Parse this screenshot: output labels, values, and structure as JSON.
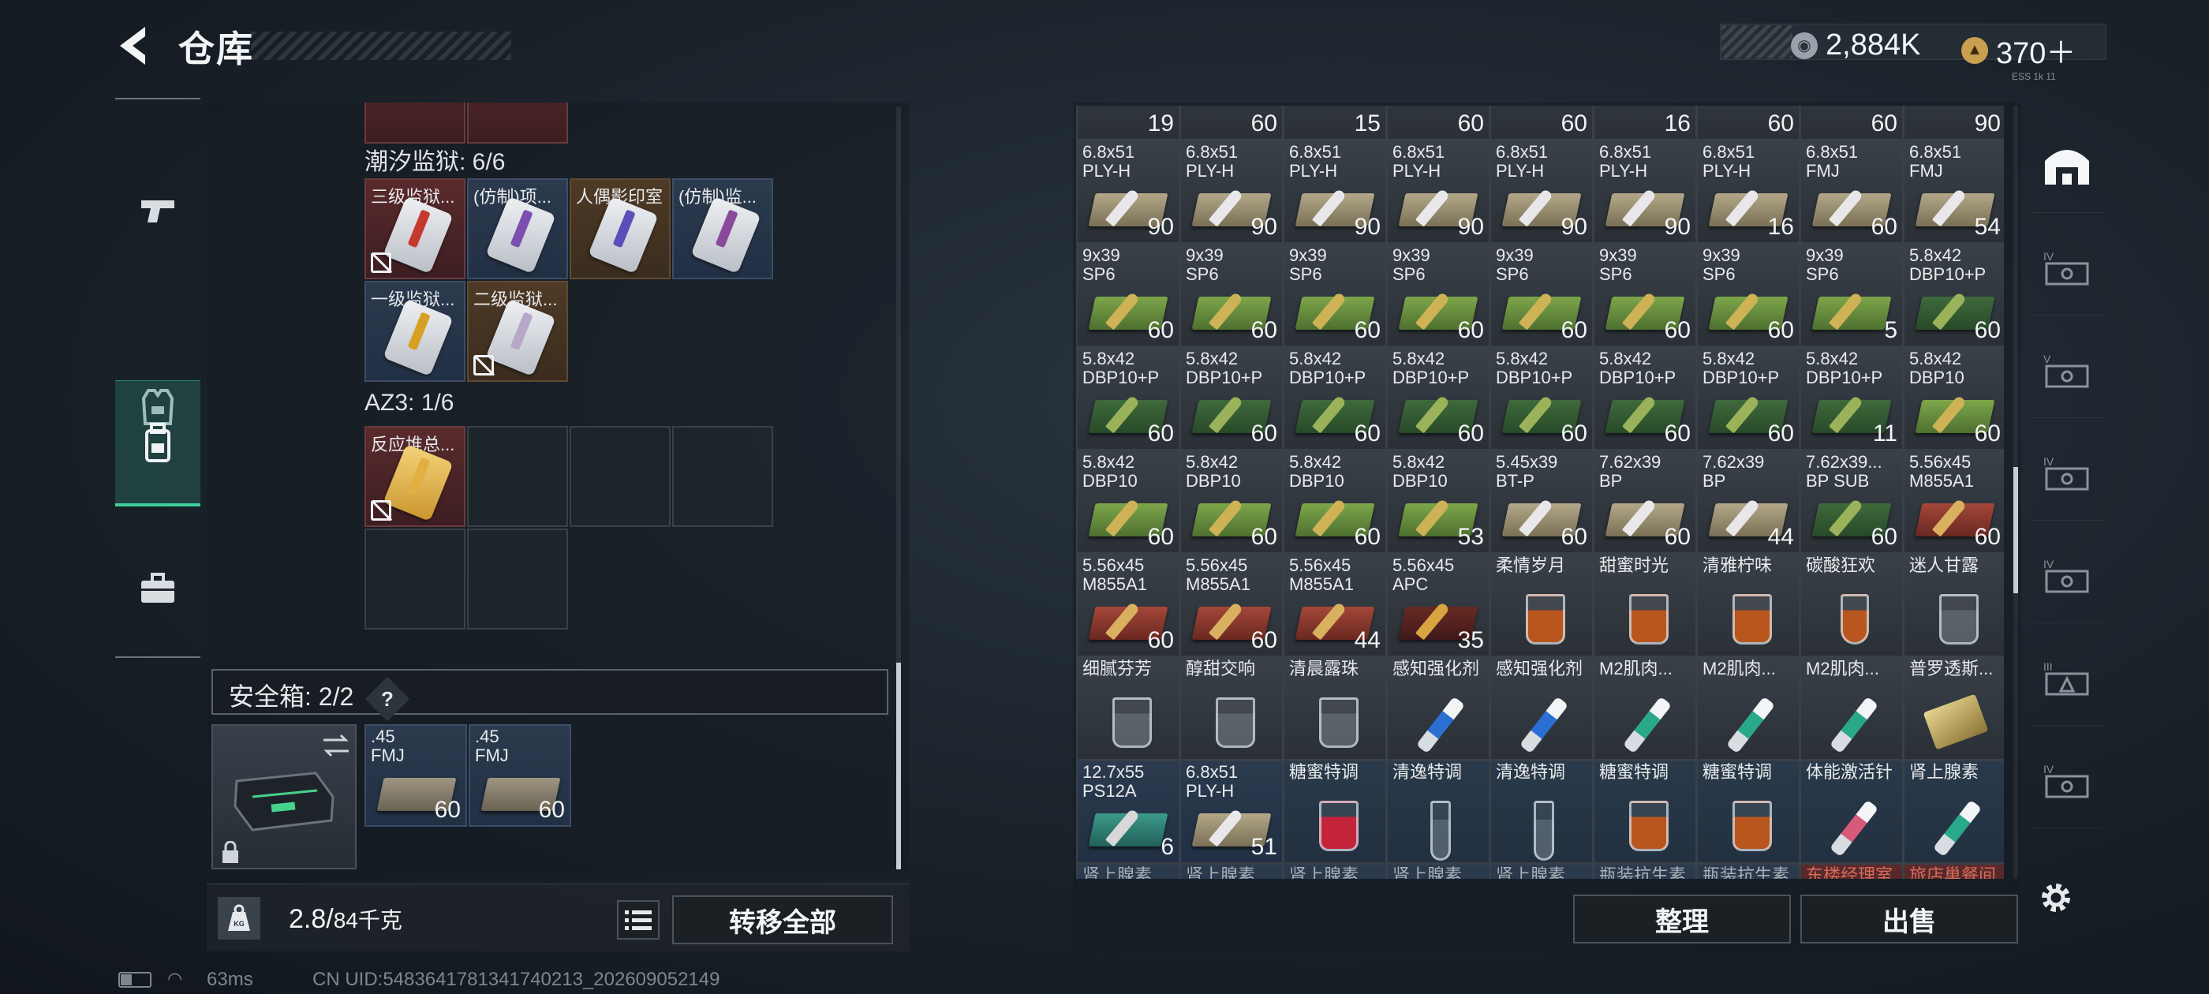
{
  "header": {
    "title": "仓库",
    "currency_silver": "2,884K",
    "currency_gold": "370＋",
    "version": "ESS 1k 11"
  },
  "left_sidebar": {
    "items": [
      {
        "icon": "pistol-icon"
      },
      {
        "icon": "vest-icon"
      },
      {
        "icon": "backpack-icon",
        "active": true
      },
      {
        "icon": "toolbox-icon"
      }
    ]
  },
  "container": {
    "top_counts": [],
    "section1_label": "潮汐监狱: 6/6",
    "section1_items": [
      {
        "name": "三级监狱...",
        "color": "red"
      },
      {
        "name": "(仿制)项...",
        "color": "blue"
      },
      {
        "name": "人偶影印室",
        "color": "brown"
      },
      {
        "name": "(仿制)监...",
        "color": "blue"
      },
      {
        "name": "一级监狱...",
        "color": "blue"
      },
      {
        "name": "二级监狱...",
        "color": "brown"
      }
    ],
    "section2_label": "AZ3: 1/6",
    "section2_items": [
      {
        "name": "反应堆总...",
        "color": "red"
      }
    ]
  },
  "safebox": {
    "label": "安全箱: 2/2",
    "help": "?",
    "items": [
      {
        "caliber": ".45\nFMJ",
        "count": "60"
      },
      {
        "caliber": ".45\nFMJ",
        "count": "60"
      }
    ]
  },
  "footer_left": {
    "weight": "2.8/",
    "weight_max": "84千克",
    "transfer_all": "转移全部"
  },
  "footer_right": {
    "organize": "整理",
    "sell": "出售"
  },
  "status": {
    "ping": "63ms",
    "uid": "CN UID:5483641781341740213_202609052149"
  },
  "stash": {
    "top_row_counts": [
      "19",
      "60",
      "15",
      "60",
      "60",
      "16",
      "60",
      "60",
      "90"
    ],
    "rows": [
      [
        {
          "n": "6.8x51\nPLY-H",
          "c": "90",
          "t": "ammo",
          "k": "tan"
        },
        {
          "n": "6.8x51\nPLY-H",
          "c": "90",
          "t": "ammo",
          "k": "tan"
        },
        {
          "n": "6.8x51\nPLY-H",
          "c": "90",
          "t": "ammo",
          "k": "tan"
        },
        {
          "n": "6.8x51\nPLY-H",
          "c": "90",
          "t": "ammo",
          "k": "tan"
        },
        {
          "n": "6.8x51\nPLY-H",
          "c": "90",
          "t": "ammo",
          "k": "tan"
        },
        {
          "n": "6.8x51\nPLY-H",
          "c": "90",
          "t": "ammo",
          "k": "tan"
        },
        {
          "n": "6.8x51\nPLY-H",
          "c": "16",
          "t": "ammo",
          "k": "tan"
        },
        {
          "n": "6.8x51\nFMJ",
          "c": "60",
          "t": "ammo",
          "k": "tan"
        },
        {
          "n": "6.8x51\nFMJ",
          "c": "54",
          "t": "ammo",
          "k": "tan"
        }
      ],
      [
        {
          "n": "9x39\nSP6",
          "c": "60",
          "t": "ammo",
          "k": "green"
        },
        {
          "n": "9x39\nSP6",
          "c": "60",
          "t": "ammo",
          "k": "green"
        },
        {
          "n": "9x39\nSP6",
          "c": "60",
          "t": "ammo",
          "k": "green"
        },
        {
          "n": "9x39\nSP6",
          "c": "60",
          "t": "ammo",
          "k": "green"
        },
        {
          "n": "9x39\nSP6",
          "c": "60",
          "t": "ammo",
          "k": "green"
        },
        {
          "n": "9x39\nSP6",
          "c": "60",
          "t": "ammo",
          "k": "green"
        },
        {
          "n": "9x39\nSP6",
          "c": "60",
          "t": "ammo",
          "k": "green"
        },
        {
          "n": "9x39\nSP6",
          "c": "5",
          "t": "ammo",
          "k": "green"
        },
        {
          "n": "5.8x42\nDBP10+P",
          "c": "60",
          "t": "ammo",
          "k": "dgreen"
        }
      ],
      [
        {
          "n": "5.8x42\nDBP10+P",
          "c": "60",
          "t": "ammo",
          "k": "dgreen"
        },
        {
          "n": "5.8x42\nDBP10+P",
          "c": "60",
          "t": "ammo",
          "k": "dgreen"
        },
        {
          "n": "5.8x42\nDBP10+P",
          "c": "60",
          "t": "ammo",
          "k": "dgreen"
        },
        {
          "n": "5.8x42\nDBP10+P",
          "c": "60",
          "t": "ammo",
          "k": "dgreen"
        },
        {
          "n": "5.8x42\nDBP10+P",
          "c": "60",
          "t": "ammo",
          "k": "dgreen"
        },
        {
          "n": "5.8x42\nDBP10+P",
          "c": "60",
          "t": "ammo",
          "k": "dgreen"
        },
        {
          "n": "5.8x42\nDBP10+P",
          "c": "60",
          "t": "ammo",
          "k": "dgreen"
        },
        {
          "n": "5.8x42\nDBP10+P",
          "c": "11",
          "t": "ammo",
          "k": "dgreen"
        },
        {
          "n": "5.8x42\nDBP10",
          "c": "60",
          "t": "ammo",
          "k": "green"
        }
      ],
      [
        {
          "n": "5.8x42\nDBP10",
          "c": "60",
          "t": "ammo",
          "k": "green"
        },
        {
          "n": "5.8x42\nDBP10",
          "c": "60",
          "t": "ammo",
          "k": "green"
        },
        {
          "n": "5.8x42\nDBP10",
          "c": "60",
          "t": "ammo",
          "k": "green"
        },
        {
          "n": "5.8x42\nDBP10",
          "c": "53",
          "t": "ammo",
          "k": "green"
        },
        {
          "n": "5.45x39\nBT-P",
          "c": "60",
          "t": "ammo",
          "k": "tan"
        },
        {
          "n": "7.62x39\nBP",
          "c": "60",
          "t": "ammo",
          "k": "tan"
        },
        {
          "n": "7.62x39\nBP",
          "c": "44",
          "t": "ammo",
          "k": "tan"
        },
        {
          "n": "7.62x39...\nBP SUB",
          "c": "60",
          "t": "ammo",
          "k": "dgreen"
        },
        {
          "n": "5.56x45\nM855A1",
          "c": "60",
          "t": "ammo",
          "k": "red"
        }
      ],
      [
        {
          "n": "5.56x45\nM855A1",
          "c": "60",
          "t": "ammo",
          "k": "red"
        },
        {
          "n": "5.56x45\nM855A1",
          "c": "60",
          "t": "ammo",
          "k": "red"
        },
        {
          "n": "5.56x45\nM855A1",
          "c": "44",
          "t": "ammo",
          "k": "red"
        },
        {
          "n": "5.56x45\nAPC",
          "c": "35",
          "t": "ammo",
          "k": "dred"
        },
        {
          "n": "柔情岁月",
          "c": "",
          "t": "glass",
          "k": "amber"
        },
        {
          "n": "甜蜜时光",
          "c": "",
          "t": "glass",
          "k": "amber"
        },
        {
          "n": "清雅柠味",
          "c": "",
          "t": "glass",
          "k": "amber"
        },
        {
          "n": "碳酸狂欢",
          "c": "",
          "t": "wine",
          "k": "amber"
        },
        {
          "n": "迷人甘露",
          "c": "",
          "t": "glass",
          "k": "clear"
        }
      ],
      [
        {
          "n": "细腻芬芳",
          "c": "",
          "t": "glass",
          "k": "clear"
        },
        {
          "n": "醇甜交响",
          "c": "",
          "t": "glass",
          "k": "clear"
        },
        {
          "n": "清晨露珠",
          "c": "",
          "t": "glass",
          "k": "clear"
        },
        {
          "n": "感知强化剂",
          "c": "",
          "t": "syringe",
          "k": "blue"
        },
        {
          "n": "感知强化剂",
          "c": "",
          "t": "syringe",
          "k": "blue"
        },
        {
          "n": "M2肌肉...",
          "c": "",
          "t": "syringe",
          "k": "teal"
        },
        {
          "n": "M2肌肉...",
          "c": "",
          "t": "syringe",
          "k": "teal"
        },
        {
          "n": "M2肌肉...",
          "c": "",
          "t": "syringe",
          "k": "teal"
        },
        {
          "n": "普罗透斯...",
          "c": "",
          "t": "device",
          "k": "gold"
        }
      ],
      [
        {
          "n": "12.7x55\nPS12A",
          "c": "6",
          "t": "ammo",
          "k": "teal"
        },
        {
          "n": "6.8x51\nPLY-H",
          "c": "51",
          "t": "ammo",
          "k": "tan"
        },
        {
          "n": "糖蜜特调",
          "c": "",
          "t": "glass",
          "k": "red"
        },
        {
          "n": "清逸特调",
          "c": "",
          "t": "flute",
          "k": "clear"
        },
        {
          "n": "清逸特调",
          "c": "",
          "t": "flute",
          "k": "clear"
        },
        {
          "n": "糖蜜特调",
          "c": "",
          "t": "glass",
          "k": "amber"
        },
        {
          "n": "糖蜜特调",
          "c": "",
          "t": "glass",
          "k": "amber"
        },
        {
          "n": "体能激活针",
          "c": "",
          "t": "syringe",
          "k": "pink"
        },
        {
          "n": "肾上腺素",
          "c": "",
          "t": "syringe",
          "k": "teal"
        }
      ],
      [
        {
          "n": "肾上腺素",
          "c": "",
          "t": "none",
          "k": "blue"
        },
        {
          "n": "肾上腺素",
          "c": "",
          "t": "none",
          "k": "blue"
        },
        {
          "n": "肾上腺素",
          "c": "",
          "t": "none",
          "k": "blue"
        },
        {
          "n": "肾上腺素",
          "c": "",
          "t": "none",
          "k": "blue"
        },
        {
          "n": "肾上腺素",
          "c": "",
          "t": "none",
          "k": "blue"
        },
        {
          "n": "瓶装抗生素",
          "c": "",
          "t": "none",
          "k": "blue"
        },
        {
          "n": "瓶装抗生素",
          "c": "",
          "t": "none",
          "k": "blue"
        },
        {
          "n": "东楼经理室",
          "c": "",
          "t": "none",
          "k": "red"
        },
        {
          "n": "旅店巢餐间",
          "c": "",
          "t": "none",
          "k": "red"
        }
      ]
    ]
  },
  "right_sidebar": {
    "items": [
      "building-icon",
      "equipment-iv-icon",
      "equipment-v-icon",
      "equipment-iv-2-icon",
      "equipment-iv-3-icon",
      "equipment-iii-icon",
      "equipment-iv-4-icon",
      "settings-gear-icon"
    ]
  }
}
